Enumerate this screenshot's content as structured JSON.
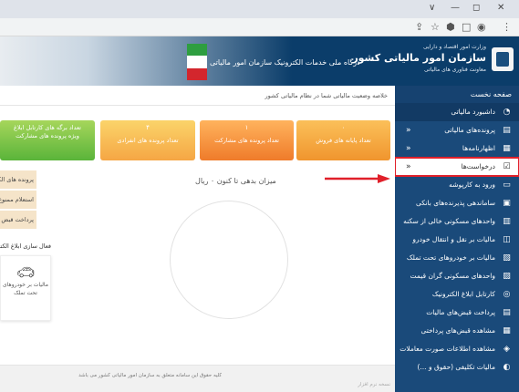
{
  "browser": {
    "window_controls": [
      "∨",
      "—",
      "◻",
      "✕"
    ],
    "toolbar_icons": [
      "share-icon",
      "star-icon",
      "bookmark-icon",
      "tab-icon",
      "profile-icon",
      "menu-icon"
    ],
    "toolbar_glyphs": [
      "⇪",
      "☆",
      "⬢",
      "□",
      "◉",
      "⋮"
    ]
  },
  "header": {
    "logo_line1": "وزارت امور اقتصاد و دارایی",
    "logo_line2": "سازمان امور مالیاتی کشور",
    "logo_line3": "معاونت فناوری های مالیاتی",
    "subtitle": "درگاه ملی خدمات الکترونیک سازمان امور مالیاتی"
  },
  "sidebar": {
    "title": "صفحه نخست",
    "items": [
      {
        "label": "داشبورد مالیاتی",
        "icon": "dashboard-icon",
        "glyph": "◔",
        "chevron": "",
        "active": true
      },
      {
        "label": "پرونده‌های مالیاتی",
        "icon": "folder-icon",
        "glyph": "▤",
        "chevron": "«"
      },
      {
        "label": "اظهارنامه‌ها",
        "icon": "document-icon",
        "glyph": "▦",
        "chevron": "«"
      },
      {
        "label": "درخواست‌ها",
        "icon": "checklist-icon",
        "glyph": "☑",
        "chevron": "«",
        "highlighted": true
      },
      {
        "label": "ورود به کارپوشه",
        "icon": "inbox-icon",
        "glyph": "▭",
        "chevron": ""
      },
      {
        "label": "ساماندهی پذیرنده‌های بانکی",
        "icon": "bank-icon",
        "glyph": "▣",
        "chevron": ""
      },
      {
        "label": "واحدهای مسکونی خالی از سکنه",
        "icon": "building-icon",
        "glyph": "▥",
        "chevron": ""
      },
      {
        "label": "مالیات بر نقل و انتقال خودرو",
        "icon": "car-icon",
        "glyph": "◫",
        "chevron": ""
      },
      {
        "label": "مالیات بر خودروهای تحت تملک",
        "icon": "vehicle-icon",
        "glyph": "▧",
        "chevron": ""
      },
      {
        "label": "واحدهای مسکونی گران قیمت",
        "icon": "house-icon",
        "glyph": "▨",
        "chevron": ""
      },
      {
        "label": "کارتابل ابلاغ الکترونیک",
        "icon": "notification-icon",
        "glyph": "◎",
        "chevron": ""
      },
      {
        "label": "پرداخت قبض‌های مالیات",
        "icon": "payment-icon",
        "glyph": "▤",
        "chevron": ""
      },
      {
        "label": "مشاهده قبض‌های پرداختی",
        "icon": "receipt-icon",
        "glyph": "▦",
        "chevron": ""
      },
      {
        "label": "مشاهده اطلاعات صورت معاملات",
        "icon": "transactions-icon",
        "glyph": "◈",
        "chevron": ""
      },
      {
        "label": "مالیات تکلیفی (حقوق و ...)",
        "icon": "salary-tax-icon",
        "glyph": "◐",
        "chevron": ""
      }
    ]
  },
  "main": {
    "breadcrumb": "خلاصه وضعیت مالیاتی شما در نظام مالیاتی کشور",
    "cards": [
      {
        "value": "۰",
        "label": "تعداد پایانه های فروش"
      },
      {
        "value": "۱",
        "label": "تعداد پرونده های مشارکت"
      },
      {
        "value": "۴",
        "label": "تعداد پرونده های انفرادی"
      },
      {
        "value": "",
        "label": "تعداد برگه های کارتابل ابلاغ",
        "label2": "ویژه پرونده های مشارکت"
      }
    ],
    "debt_text": "میزان بدهی تا کنون ۰ ریال",
    "quick_links": [
      "پرونده های الکترو",
      "استعلام ممنوع الخ",
      "پرداخت قبض های"
    ],
    "notify_title": "فعال سازی ابلاغ الکترونیک",
    "small_card": {
      "line1": "مالیات بر خودروهای",
      "line2": "تحت تملک"
    },
    "footer_line1": "کلیه حقوق این سامانه متعلق به سازمان امور مالیاتی کشور می باشد",
    "footer_line2": "نسخه نرم افزار"
  }
}
